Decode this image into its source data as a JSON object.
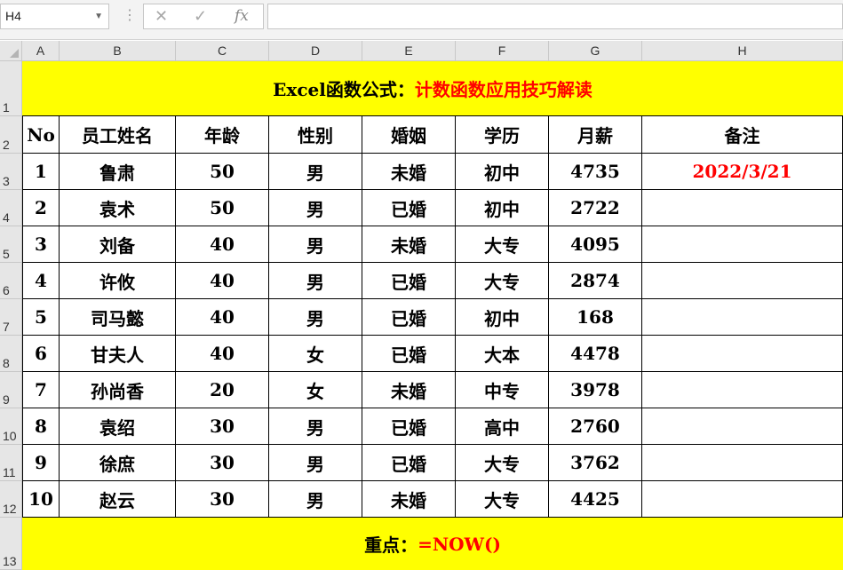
{
  "toolbar": {
    "name_box": "H4",
    "cancel_symbol": "✕",
    "enter_symbol": "✓",
    "fx_symbol": "fx",
    "formula_value": ""
  },
  "columns": [
    "A",
    "B",
    "C",
    "D",
    "E",
    "F",
    "G",
    "H"
  ],
  "rows": [
    "1",
    "2",
    "3",
    "4",
    "5",
    "6",
    "7",
    "8",
    "9",
    "10",
    "11",
    "12",
    "13"
  ],
  "title": {
    "prefix": "Excel函数公式：",
    "highlight": "计数函数应用技巧解读"
  },
  "headers": [
    "No",
    "员工姓名",
    "年龄",
    "性别",
    "婚姻",
    "学历",
    "月薪",
    "备注"
  ],
  "table": [
    [
      "1",
      "鲁肃",
      "50",
      "男",
      "未婚",
      "初中",
      "4735",
      "2022/3/21"
    ],
    [
      "2",
      "袁术",
      "50",
      "男",
      "已婚",
      "初中",
      "2722",
      ""
    ],
    [
      "3",
      "刘备",
      "40",
      "男",
      "未婚",
      "大专",
      "4095",
      ""
    ],
    [
      "4",
      "许攸",
      "40",
      "男",
      "已婚",
      "大专",
      "2874",
      ""
    ],
    [
      "5",
      "司马懿",
      "40",
      "男",
      "已婚",
      "初中",
      "168",
      ""
    ],
    [
      "6",
      "甘夫人",
      "40",
      "女",
      "已婚",
      "大本",
      "4478",
      ""
    ],
    [
      "7",
      "孙尚香",
      "20",
      "女",
      "未婚",
      "中专",
      "3978",
      ""
    ],
    [
      "8",
      "袁绍",
      "30",
      "男",
      "已婚",
      "高中",
      "2760",
      ""
    ],
    [
      "9",
      "徐庶",
      "30",
      "男",
      "已婚",
      "大专",
      "3762",
      ""
    ],
    [
      "10",
      "赵云",
      "30",
      "男",
      "未婚",
      "大专",
      "4425",
      ""
    ]
  ],
  "footer": {
    "prefix": "重点：",
    "highlight": "=NOW()"
  },
  "colors": {
    "banner_bg": "#ffff00",
    "accent_text": "#ff0000",
    "header_bg": "#e6e6e6"
  }
}
